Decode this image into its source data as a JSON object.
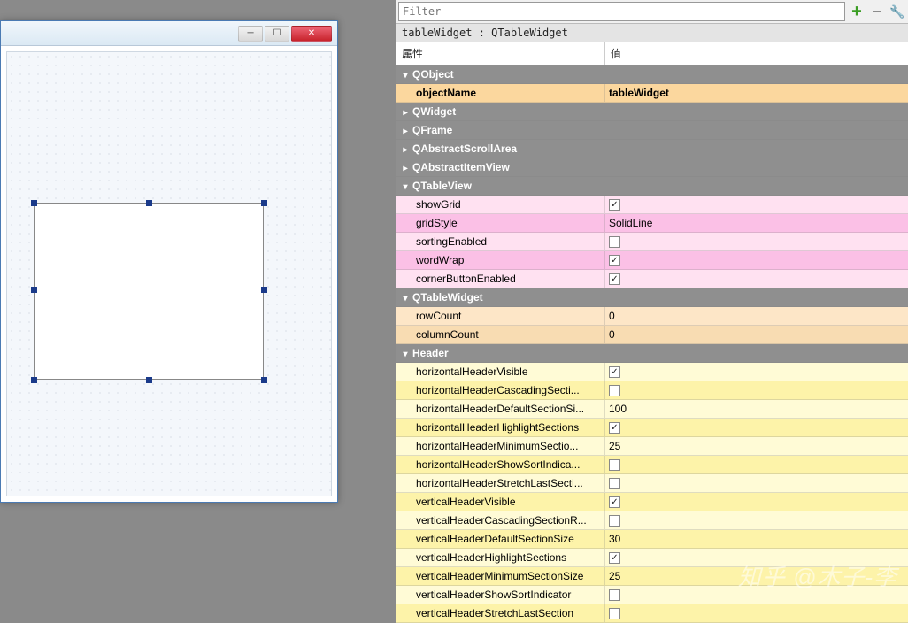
{
  "filter": {
    "placeholder": "Filter"
  },
  "objectLabel": "tableWidget : QTableWidget",
  "columns": {
    "name": "属性",
    "value": "值"
  },
  "groups": [
    {
      "key": "QObject",
      "label": "QObject",
      "expanded": true
    },
    {
      "key": "QWidget",
      "label": "QWidget",
      "expanded": false
    },
    {
      "key": "QFrame",
      "label": "QFrame",
      "expanded": false
    },
    {
      "key": "QAbstractScrollArea",
      "label": "QAbstractScrollArea",
      "expanded": false
    },
    {
      "key": "QAbstractItemView",
      "label": "QAbstractItemView",
      "expanded": false
    },
    {
      "key": "QTableView",
      "label": "QTableView",
      "expanded": true
    },
    {
      "key": "QTableWidget",
      "label": "QTableWidget",
      "expanded": true
    },
    {
      "key": "Header",
      "label": "Header",
      "expanded": true
    }
  ],
  "props": {
    "QObject": [
      {
        "name": "objectName",
        "value": "tableWidget",
        "bold": true
      }
    ],
    "QTableView": [
      {
        "name": "showGrid",
        "type": "check",
        "checked": true
      },
      {
        "name": "gridStyle",
        "type": "text",
        "value": "SolidLine"
      },
      {
        "name": "sortingEnabled",
        "type": "check",
        "checked": false
      },
      {
        "name": "wordWrap",
        "type": "check",
        "checked": true
      },
      {
        "name": "cornerButtonEnabled",
        "type": "check",
        "checked": true
      }
    ],
    "QTableWidget": [
      {
        "name": "rowCount",
        "type": "text",
        "value": "0"
      },
      {
        "name": "columnCount",
        "type": "text",
        "value": "0"
      }
    ],
    "Header": [
      {
        "name": "horizontalHeaderVisible",
        "type": "check",
        "checked": true
      },
      {
        "name": "horizontalHeaderCascadingSecti...",
        "type": "check",
        "checked": false
      },
      {
        "name": "horizontalHeaderDefaultSectionSi...",
        "type": "text",
        "value": "100"
      },
      {
        "name": "horizontalHeaderHighlightSections",
        "type": "check",
        "checked": true
      },
      {
        "name": "horizontalHeaderMinimumSectio...",
        "type": "text",
        "value": "25"
      },
      {
        "name": "horizontalHeaderShowSortIndica...",
        "type": "check",
        "checked": false
      },
      {
        "name": "horizontalHeaderStretchLastSecti...",
        "type": "check",
        "checked": false
      },
      {
        "name": "verticalHeaderVisible",
        "type": "check",
        "checked": true
      },
      {
        "name": "verticalHeaderCascadingSectionR...",
        "type": "check",
        "checked": false
      },
      {
        "name": "verticalHeaderDefaultSectionSize",
        "type": "text",
        "value": "30"
      },
      {
        "name": "verticalHeaderHighlightSections",
        "type": "check",
        "checked": true
      },
      {
        "name": "verticalHeaderMinimumSectionSize",
        "type": "text",
        "value": "25"
      },
      {
        "name": "verticalHeaderShowSortIndicator",
        "type": "check",
        "checked": false
      },
      {
        "name": "verticalHeaderStretchLastSection",
        "type": "check",
        "checked": false
      }
    ]
  },
  "watermark": "知乎 @木子-李"
}
